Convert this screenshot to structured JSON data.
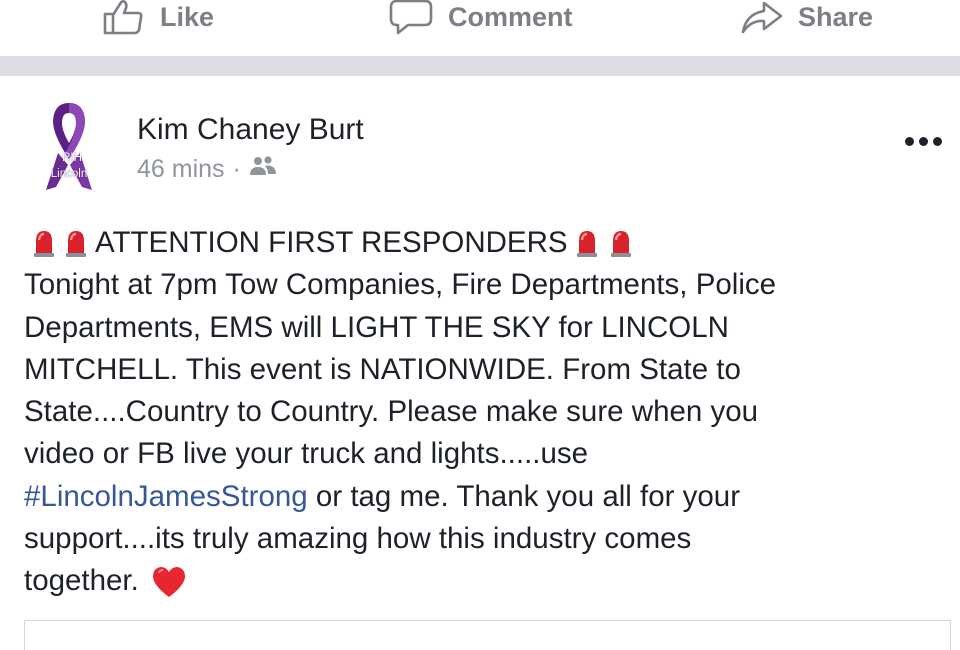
{
  "actions": {
    "like": "Like",
    "comment": "Comment",
    "share": "Share"
  },
  "post": {
    "avatar": {
      "ribbon_color": "#6a2b93",
      "label_top": "RIH",
      "label_bottom": "Lincoln"
    },
    "author": "Kim Chaney Burt",
    "time": "46 mins",
    "separator": "·",
    "audience_icon": "friends-icon",
    "body": {
      "headline": "ATTENTION FIRST RESPONDERS",
      "headline_icons": "siren-emoji",
      "line1": "Tonight at 7pm Tow Companies, Fire Departments, Police",
      "line2": "Departments, EMS will LIGHT THE SKY for LINCOLN",
      "line3": "MITCHELL. This event is NATIONWIDE. From State to",
      "line4": "State....Country to Country. Please make sure when you",
      "line5": "video or FB live your truck and lights.....use",
      "hashtag": "#LincolnJamesStrong",
      "line6_rest": " or tag me. Thank you all for your",
      "line7": "support....its truly amazing how this industry comes",
      "line8": "together.",
      "end_icon": "red-heart-emoji"
    }
  },
  "colors": {
    "action_gray": "#7b7f86",
    "meta_gray": "#90949c",
    "link_blue": "#365899",
    "divider": "#dcdee3",
    "heart": "#e8262f",
    "siren": "#d9232c"
  }
}
